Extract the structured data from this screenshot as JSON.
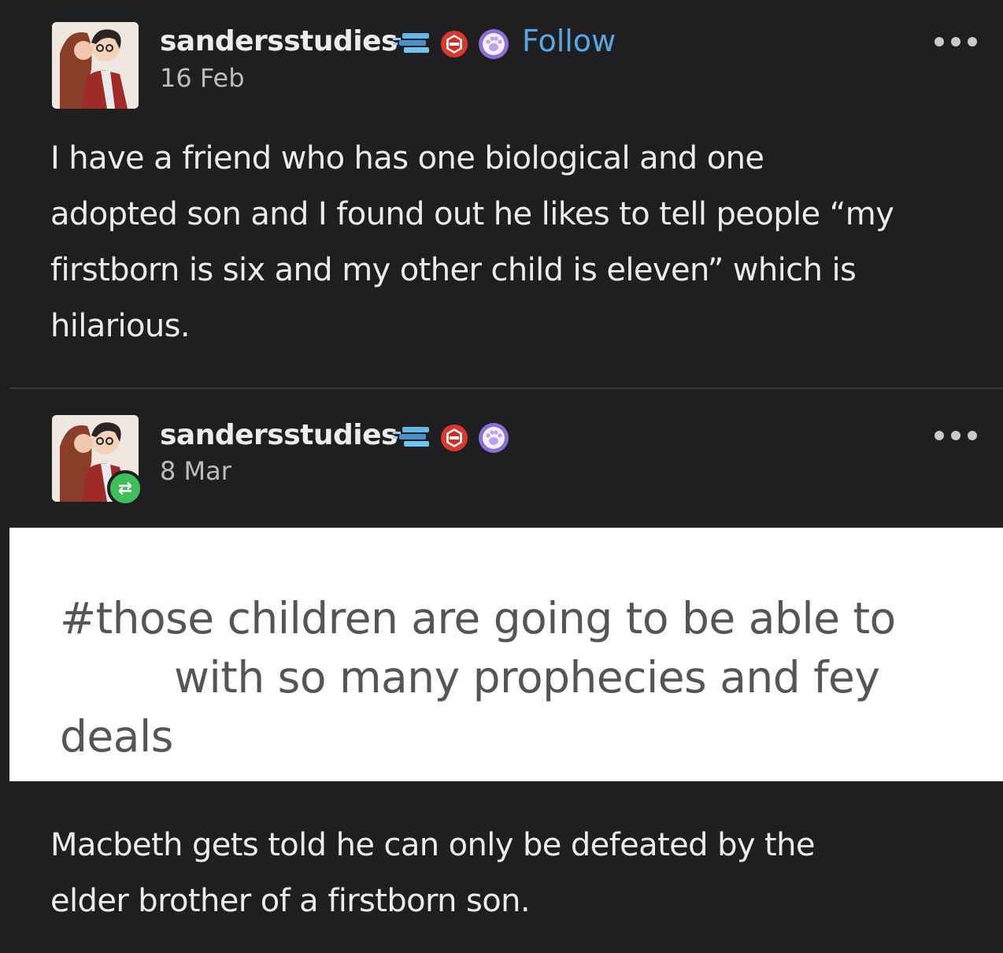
{
  "post": {
    "author": "sandersstudies",
    "date": "16 Feb",
    "follow_label": "Follow",
    "body": [
      "I have a friend who has one biological and one",
      "adopted son and I found out he likes to tell people “my",
      "firstborn is six and my other child is eleven” which is",
      "hilarious."
    ]
  },
  "reblog": {
    "author": "sandersstudies",
    "date": "8 Mar",
    "tags": [
      "#those children are going to be able to",
      "with so many prophecies and fey",
      "deals"
    ],
    "body": [
      "Macbeth gets told he can only be defeated by the",
      "elder brother of a firstborn son."
    ]
  },
  "icons": {
    "more": "more-options-icon",
    "reblog": "reblog-icon",
    "badge1": "stacked-books-icon",
    "badge2": "red-hexagon-badge-icon",
    "badge3": "purple-paw-badge-icon"
  },
  "colors": {
    "background": "#1f1f21",
    "text": "#ececec",
    "follow": "#58a6e6",
    "reblog_badge": "#3fbf5a",
    "tags_panel": "#ffffff",
    "tags_text": "#555555"
  }
}
